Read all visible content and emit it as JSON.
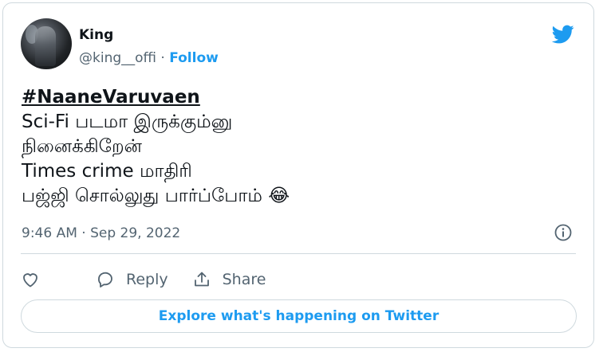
{
  "author": {
    "name": "King",
    "handle": "@king__offi",
    "separator": "·",
    "follow_label": "Follow"
  },
  "tweet": {
    "hashtag": "#NaaneVaruvaen",
    "lines": [
      "Sci-Fi படமா இருக்கும்னு",
      "நினைக்கிறேன்",
      "Times crime மாதிரி",
      "பஜ்ஜி சொல்லுது பார்ப்போம் 😂"
    ],
    "timestamp": "9:46 AM · Sep 29, 2022"
  },
  "actions": {
    "like_label": "",
    "reply_label": "Reply",
    "share_label": "Share"
  },
  "explore_label": "Explore what's happening on Twitter",
  "colors": {
    "accent": "#1d9bf0",
    "text": "#0f1419",
    "secondary": "#536471",
    "border": "#cfd9de"
  },
  "icons": [
    "twitter-bird-icon",
    "info-icon",
    "heart-icon",
    "reply-bubble-icon",
    "share-icon"
  ]
}
